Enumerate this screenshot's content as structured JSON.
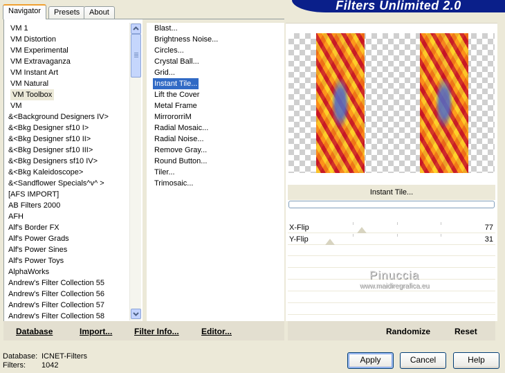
{
  "tabs": [
    {
      "label": "Navigator",
      "active": true
    },
    {
      "label": "Presets",
      "active": false
    },
    {
      "label": "About",
      "active": false
    }
  ],
  "banner": {
    "title": "Filters Unlimited 2.0"
  },
  "categories": {
    "selected": "VM Toolbox",
    "items": [
      "VM 1",
      "VM Distortion",
      "VM Experimental",
      "VM Extravaganza",
      "VM Instant Art",
      "VM Natural",
      "VM Toolbox",
      "VM",
      "&<Background Designers IV>",
      "&<Bkg Designer sf10 I>",
      "&<Bkg Designer sf10 II>",
      "&<Bkg Designer sf10 III>",
      "&<Bkg Designers sf10 IV>",
      "&<Bkg Kaleidoscope>",
      "&<Sandflower Specials^v^ >",
      "[AFS IMPORT]",
      "AB Filters 2000",
      "AFH",
      "Alf's Border FX",
      "Alf's Power Grads",
      "Alf's Power Sines",
      "Alf's Power Toys",
      "AlphaWorks",
      "Andrew's Filter Collection 55",
      "Andrew's Filter Collection 56",
      "Andrew's Filter Collection 57",
      "Andrew's Filter Collection 58"
    ]
  },
  "filters": {
    "selected": "Instant Tile...",
    "items": [
      "Blast...",
      "Brightness Noise...",
      "Circles...",
      "Crystal Ball...",
      "Grid...",
      "Instant Tile...",
      "Lift the Cover",
      "Metal Frame",
      "MirrororriM",
      "Radial Mosaic...",
      "Radial Noise...",
      "Remove Gray...",
      "Round Button...",
      "Tiler...",
      "Trimosaic..."
    ]
  },
  "bottom_bar": {
    "database": "Database",
    "import": "Import...",
    "filter_info": "Filter Info...",
    "editor": "Editor...",
    "randomize": "Randomize",
    "reset": "Reset"
  },
  "preview": {
    "filter_name": "Instant Tile..."
  },
  "params": [
    {
      "label": "X-Flip",
      "value": 77,
      "max": 255
    },
    {
      "label": "Y-Flip",
      "value": 31,
      "max": 255
    }
  ],
  "watermark": {
    "name": "Pinuccia",
    "url": "www.maidiregrafica.eu"
  },
  "status": {
    "database_label": "Database:",
    "database_value": "ICNET-Filters",
    "filters_label": "Filters:",
    "filters_value": "1042"
  },
  "buttons": {
    "apply": "Apply",
    "cancel": "Cancel",
    "help": "Help"
  },
  "colors": {
    "selection": "#316ac5",
    "banner": "#0a1f8a",
    "dialog_bg": "#ece9d8"
  }
}
